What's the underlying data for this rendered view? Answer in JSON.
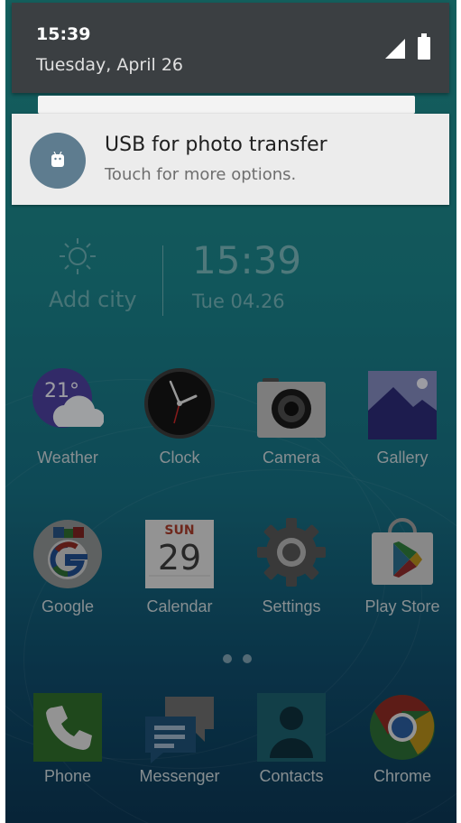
{
  "status_shade": {
    "time": "15:39",
    "date": "Tuesday, April 26"
  },
  "notification": {
    "title": "USB for photo transfer",
    "subtitle": "Touch for more options."
  },
  "clock_widget": {
    "add_city": "Add city",
    "time": "15:39",
    "date": "Tue  04.26"
  },
  "apps": {
    "weather": {
      "label": "Weather",
      "temp": "21°"
    },
    "clock": {
      "label": "Clock"
    },
    "camera": {
      "label": "Camera"
    },
    "gallery": {
      "label": "Gallery"
    },
    "google": {
      "label": "Google"
    },
    "calendar": {
      "label": "Calendar",
      "day_name": "SUN",
      "day_number": "29"
    },
    "settings": {
      "label": "Settings"
    },
    "play_store": {
      "label": "Play Store"
    }
  },
  "dock": {
    "phone": {
      "label": "Phone"
    },
    "messenger": {
      "label": "Messenger"
    },
    "contacts": {
      "label": "Contacts"
    },
    "chrome": {
      "label": "Chrome"
    }
  },
  "colors": {
    "shade_bg": "#3b3f42",
    "notif_bg": "#ececec",
    "avatar_bg": "#5e7c8f"
  }
}
